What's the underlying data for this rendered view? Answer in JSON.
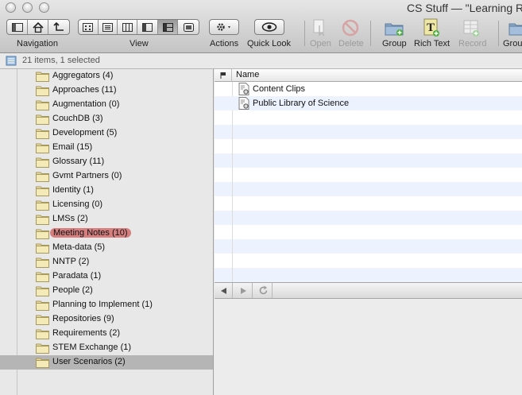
{
  "window": {
    "title": "CS Stuff — \"Learning Re"
  },
  "toolbar": {
    "navigation_label": "Navigation",
    "view_label": "View",
    "actions_label": "Actions",
    "quicklook_label": "Quick Look",
    "open_label": "Open",
    "delete_label": "Delete",
    "group_label": "Group",
    "richtext_label": "Rich Text",
    "record_label": "Record",
    "group2_label": "Grou"
  },
  "status": {
    "text": "21 items, 1 selected"
  },
  "sidebar": {
    "items": [
      {
        "label": "Aggregators (4)"
      },
      {
        "label": "Approaches (11)"
      },
      {
        "label": "Augmentation (0)"
      },
      {
        "label": "CouchDB (3)"
      },
      {
        "label": "Development (5)"
      },
      {
        "label": "Email (15)"
      },
      {
        "label": "Glossary (11)"
      },
      {
        "label": "Gvmt Partners (0)"
      },
      {
        "label": "Identity (1)"
      },
      {
        "label": "Licensing (0)"
      },
      {
        "label": "LMSs (2)"
      },
      {
        "label": "Meeting Notes (10)"
      },
      {
        "label": "Meta-data (5)"
      },
      {
        "label": "NNTP (2)"
      },
      {
        "label": "Paradata (1)"
      },
      {
        "label": "People (2)"
      },
      {
        "label": "Planning to Implement (1)"
      },
      {
        "label": "Repositories (9)"
      },
      {
        "label": "Requirements (2)"
      },
      {
        "label": "STEM Exchange (1)"
      },
      {
        "label": "User Scenarios (2)"
      }
    ],
    "tag_color": "#d57f7f",
    "selected_index": 20
  },
  "list": {
    "header_name": "Name",
    "rows": [
      {
        "label": "Content Clips"
      },
      {
        "label": "Public Library of Science"
      }
    ]
  },
  "colors": {
    "alt_row": "#edf3fe",
    "selection_gray": "#b5b5b5"
  }
}
